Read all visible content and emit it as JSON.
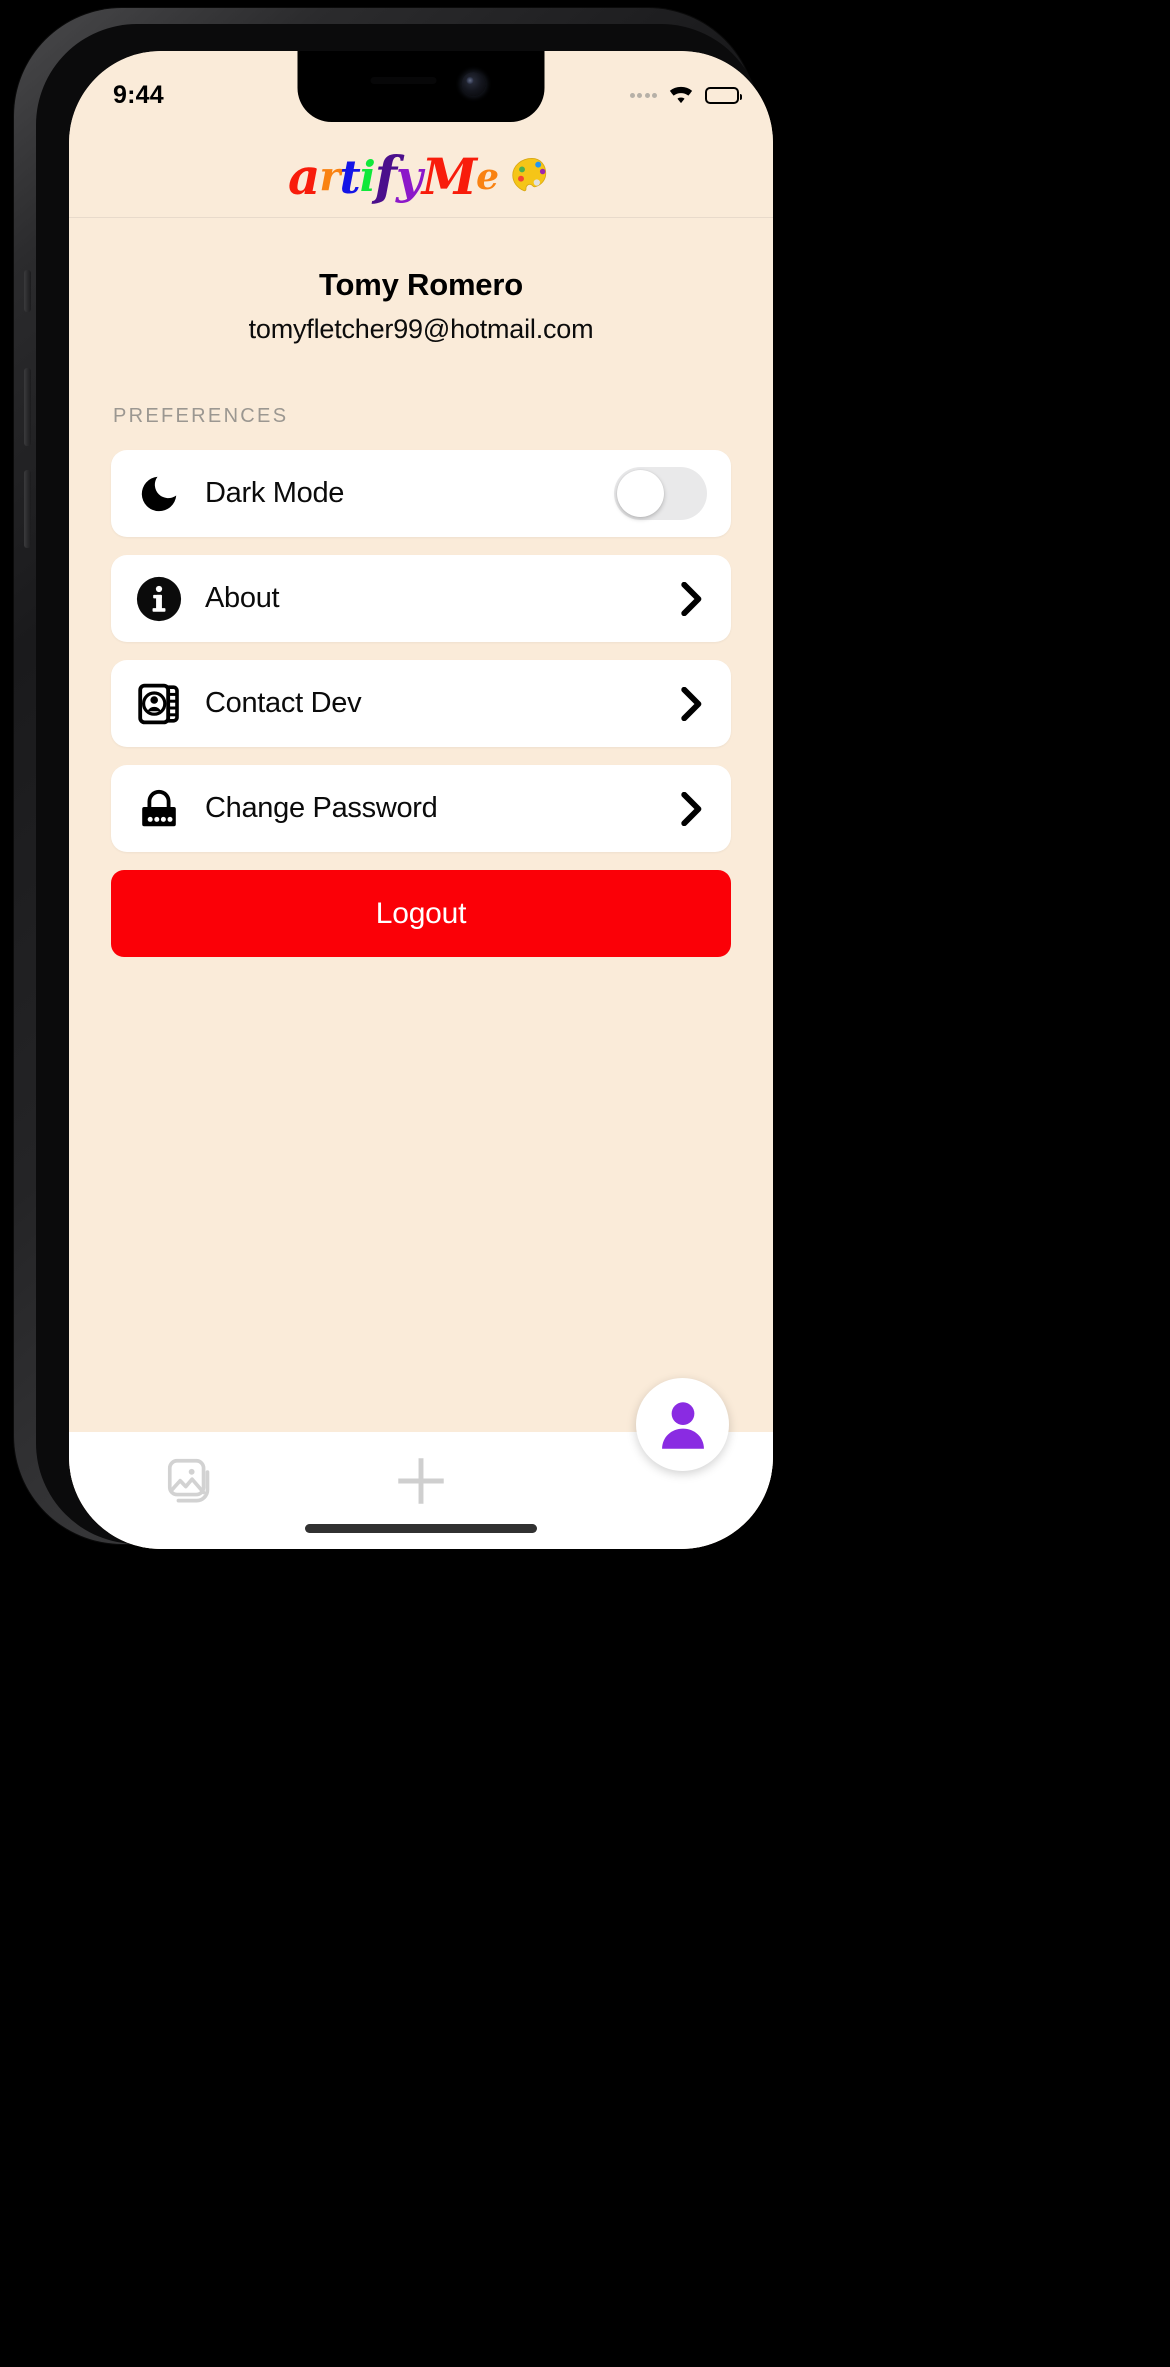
{
  "status_bar": {
    "time": "9:44",
    "signal_icon": "signal-dots-icon",
    "wifi_icon": "wifi-icon",
    "battery_icon": "battery-full-icon"
  },
  "header": {
    "app_name": "ArtifyMe",
    "logo_letters": [
      {
        "char": "a",
        "color": "#F81C0B",
        "cls": "l-a"
      },
      {
        "char": "r",
        "color": "#F98212",
        "cls": "l-r"
      },
      {
        "char": "t",
        "color": "#1414E6",
        "cls": "l-t"
      },
      {
        "char": "i",
        "color": "#10E83A",
        "cls": "l-i"
      },
      {
        "char": "f",
        "color": "#4B0F8C",
        "cls": "l-f"
      },
      {
        "char": "y",
        "color": "#8C18C9",
        "cls": "l-y"
      },
      {
        "char": "M",
        "color": "#F81C0B",
        "cls": "l-M"
      },
      {
        "char": "e",
        "color": "#F98212",
        "cls": "l-e"
      }
    ],
    "palette_icon": "artist-palette-icon"
  },
  "profile": {
    "name": "Tomy Romero",
    "email": "tomyfletcher99@hotmail.com"
  },
  "preferences": {
    "section_label": "PREFERENCES",
    "items": [
      {
        "label": "Dark Mode",
        "icon": "moon-icon",
        "control": "toggle",
        "value": "off"
      },
      {
        "label": "About",
        "icon": "info-circle-icon",
        "control": "chevron",
        "value": ""
      },
      {
        "label": "Contact Dev",
        "icon": "contact-book-icon",
        "control": "chevron",
        "value": ""
      },
      {
        "label": "Change Password",
        "icon": "lock-icon",
        "control": "chevron",
        "value": ""
      }
    ]
  },
  "logout": {
    "label": "Logout",
    "color": "#FB0007"
  },
  "bottom_nav": {
    "gallery_icon": "image-gallery-icon",
    "add_icon": "plus-icon",
    "profile_fab_icon": "person-avatar-icon",
    "fab_accent": "#8A2BE2",
    "home_indicator": "home-indicator"
  },
  "theme": {
    "background": "#FAEBD9",
    "card_background": "#FFFFFF",
    "section_label_color": "#9B9791"
  }
}
